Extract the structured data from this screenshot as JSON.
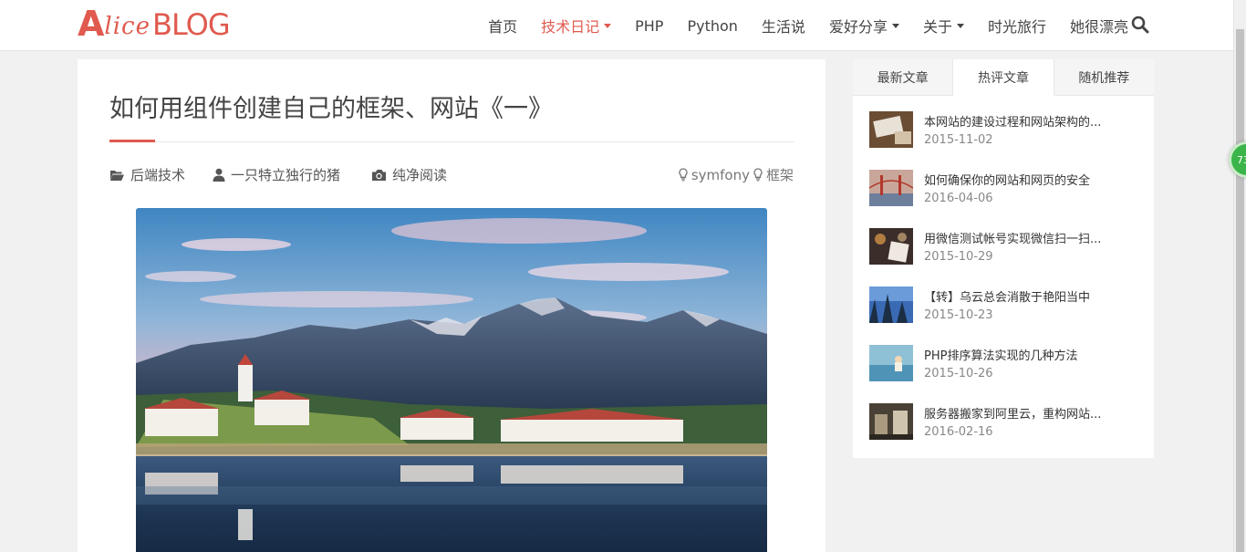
{
  "logo": {
    "part1": "A",
    "part2": "lice",
    "part3": "BLOG"
  },
  "nav": [
    {
      "label": "首页",
      "dropdown": false,
      "active": false
    },
    {
      "label": "技术日记",
      "dropdown": true,
      "active": true
    },
    {
      "label": "PHP",
      "dropdown": false,
      "active": false
    },
    {
      "label": "Python",
      "dropdown": false,
      "active": false
    },
    {
      "label": "生活说",
      "dropdown": false,
      "active": false
    },
    {
      "label": "爱好分享",
      "dropdown": true,
      "active": false
    },
    {
      "label": "关于",
      "dropdown": true,
      "active": false
    },
    {
      "label": "时光旅行",
      "dropdown": false,
      "active": false
    },
    {
      "label": "她很漂亮",
      "dropdown": false,
      "active": false
    }
  ],
  "search_icon": "search-icon",
  "article": {
    "title": "如何用组件创建自己的框架、网站《一》",
    "category": "后端技术",
    "author": "一只特立独行的猪",
    "reader_mode": "纯净阅读",
    "tags": [
      "symfony",
      "框架"
    ]
  },
  "sidebar": {
    "tabs": [
      "最新文章",
      "热评文章",
      "随机推荐"
    ],
    "active_tab": 1,
    "posts": [
      {
        "title": "本网站的建设过程和网站架构的...",
        "date": "2015-11-02"
      },
      {
        "title": "如何确保你的网站和网页的安全",
        "date": "2016-04-06"
      },
      {
        "title": "用微信测试帐号实现微信扫一扫...",
        "date": "2015-10-29"
      },
      {
        "title": "【转】乌云总会消散于艳阳当中",
        "date": "2015-10-23"
      },
      {
        "title": "PHP排序算法实现的几种方法",
        "date": "2015-10-26"
      },
      {
        "title": "服务器搬家到阿里云，重构网站...",
        "date": "2016-02-16"
      }
    ]
  },
  "float_badge": "73",
  "colors": {
    "accent": "#e05a4f",
    "badge": "#3bb54a"
  }
}
